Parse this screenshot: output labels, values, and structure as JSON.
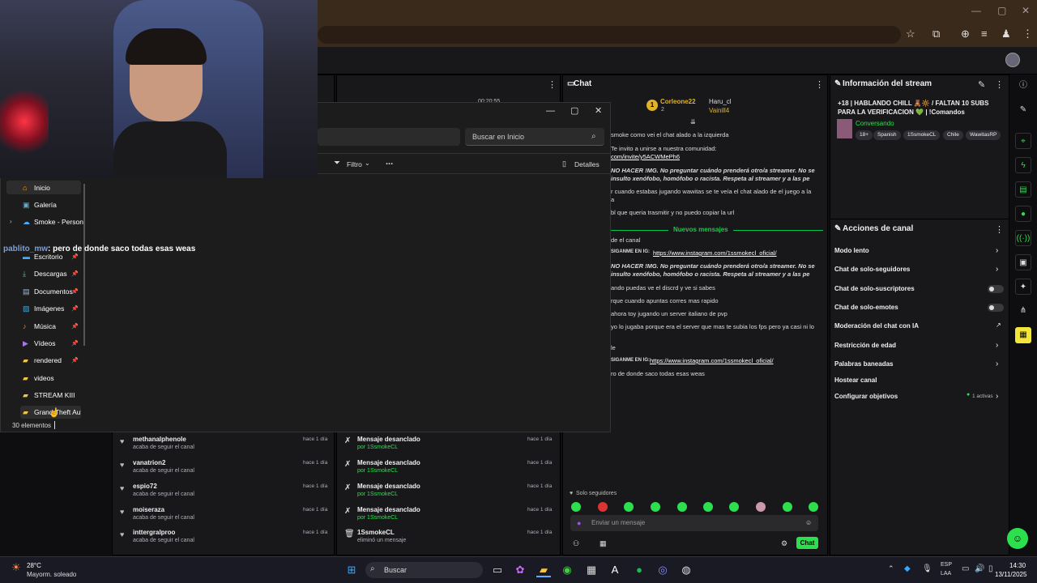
{
  "browser": {
    "icons": [
      "star-icon",
      "extensions-icon",
      "download-icon",
      "playlist-icon",
      "profile-icon",
      "menu-icon"
    ]
  },
  "explorer": {
    "search_placeholder": "Buscar en Inicio",
    "filter_label": "Filtro",
    "more_label": "...",
    "details_label": "Detalles",
    "nav": [
      {
        "label": "Inicio",
        "icon": "home-icon",
        "pinned": false
      },
      {
        "label": "Galería",
        "icon": "gallery-icon",
        "pinned": false
      },
      {
        "label": "Smoke - Person",
        "icon": "cloud-icon",
        "pinned": false
      },
      {
        "label": "Escritorio",
        "icon": "desktop-icon",
        "pinned": true
      },
      {
        "label": "Descargas",
        "icon": "download-icon",
        "pinned": true
      },
      {
        "label": "Documentos",
        "icon": "documents-icon",
        "pinned": true
      },
      {
        "label": "Imágenes",
        "icon": "images-icon",
        "pinned": true
      },
      {
        "label": "Música",
        "icon": "music-icon",
        "pinned": true
      },
      {
        "label": "Vídeos",
        "icon": "videos-icon",
        "pinned": true
      },
      {
        "label": "rendered",
        "icon": "folder-icon",
        "pinned": true
      },
      {
        "label": "videos",
        "icon": "folder-icon",
        "pinned": false
      },
      {
        "label": "STREAM KIII",
        "icon": "folder-icon",
        "pinned": false
      },
      {
        "label": "Grand Theft Aut",
        "icon": "folder-icon",
        "pinned": false
      }
    ],
    "status": "30 elementos"
  },
  "overlay_chat": {
    "user": "pablito_mw",
    "message": ": pero de donde saco todas esas weas"
  },
  "stream_time": "00:20:55",
  "chat": {
    "title": "Chat",
    "top_chatters": [
      {
        "name": "Corleone22",
        "count": "1"
      },
      {
        "name": "Haru_cl",
        "count": "1"
      },
      {
        "name": "Vainill4",
        "count": "1"
      }
    ],
    "top_badge": "1",
    "second_badge": "2",
    "lines": [
      {
        "text": "smoke como vei el chat alado a la izquierda"
      },
      {
        "text": "Te invito a unirse a nuestra comunidad:"
      },
      {
        "text": "com/invite/y5ACWMePh6"
      },
      {
        "text": "NO HACER !MG. No preguntar cuándo prenderá otro/a streamer. No se"
      },
      {
        "text": "insulto xenófobo, homófobo o racista. Respeta al streamer y a las pe"
      },
      {
        "text": "r cuando estabas jugando wawitas se te veía el chat alado de el juego a la"
      },
      {
        "text": "a"
      },
      {
        "text": "bl que queria trasmitir y no puedo copiar la url"
      }
    ],
    "new_messages_label": "Nuevos mensajes",
    "lines2": [
      {
        "text": "de el canal"
      },
      {
        "prefix": "SIGANME EN IG:",
        "link": "https://www.instagram.com/1ssmokecl_oficial/"
      },
      {
        "text": "NO HACER !MG. No preguntar cuándo prenderá otro/a streamer. No se"
      },
      {
        "text": "insulto xenófobo, homófobo o racista. Respeta al streamer y a las pe"
      },
      {
        "text": "ando puedas ve el discrd y ve si sabes"
      },
      {
        "text": "rque cuando apuntas corres mas rapido"
      },
      {
        "text": "ahora toy jugando un server italiano de pvp"
      },
      {
        "text": "yo lo jugaba porque era el server que mas te subia los fps pero ya casi ni lo"
      },
      {
        "text": "le"
      },
      {
        "prefix": "SIGANME EN IG:",
        "link": "https://www.instagram.com/1ssmokecl_oficial/"
      },
      {
        "text": "ro de donde saco todas esas weas"
      }
    ],
    "followers_only": "Solo seguidores",
    "input_placeholder": "Enviar un mensaje",
    "send_label": "Chat"
  },
  "info": {
    "title": "Información del stream",
    "stream_title": "+18 | HABLANDO CHILL 🧸🔆 / FALTAN 10 SUBS PARA LA VERIFICACION 💚 | !Comandos",
    "category": "Conversando",
    "tags": [
      "18+",
      "Spanish",
      "1SsmokeCL",
      "Chile",
      "WawitasRP"
    ]
  },
  "actions": {
    "title": "Acciones de canal",
    "items": [
      {
        "label": "Modo lento",
        "kind": "chevron"
      },
      {
        "label": "Chat de solo-seguidores",
        "kind": "chevron"
      },
      {
        "label": "Chat de solo-suscriptores",
        "kind": "toggle"
      },
      {
        "label": "Chat de solo-emotes",
        "kind": "toggle"
      },
      {
        "label": "Moderación del chat con IA",
        "kind": "external"
      },
      {
        "label": "Restricción de edad",
        "kind": "chevron"
      },
      {
        "label": "Palabras baneadas",
        "kind": "chevron"
      },
      {
        "label": "Hostear canal",
        "kind": "none"
      },
      {
        "label": "Configurar objetivos",
        "kind": "goals"
      }
    ],
    "goals_active": "1 activas"
  },
  "feed_left": [
    {
      "name": "methanalphenole",
      "sub": "acaba de seguir el canal",
      "time": "hace 1 día"
    },
    {
      "name": "vanatrion2",
      "sub": "acaba de seguir el canal",
      "time": "hace 1 día"
    },
    {
      "name": "espio72",
      "sub": "acaba de seguir el canal",
      "time": "hace 1 día"
    },
    {
      "name": "moiseraza",
      "sub": "acaba de seguir el canal",
      "time": "hace 1 día"
    },
    {
      "name": "inttergralproo",
      "sub": "acaba de seguir el canal",
      "time": "hace 1 día"
    }
  ],
  "feed_right": [
    {
      "name": "Mensaje desanclado",
      "sub": "por 1SsmokeCL",
      "time": "hace 1 día",
      "icon": "unpin-icon"
    },
    {
      "name": "Mensaje desanclado",
      "sub": "por 1SsmokeCL",
      "time": "hace 1 día",
      "icon": "unpin-icon"
    },
    {
      "name": "Mensaje desanclado",
      "sub": "por 1SsmokeCL",
      "time": "hace 1 día",
      "icon": "unpin-icon"
    },
    {
      "name": "Mensaje desanclado",
      "sub": "por 1SsmokeCL",
      "time": "hace 1 día",
      "icon": "unpin-icon"
    },
    {
      "name": "1SsmokeCL",
      "sub": "eliminó un mensaje",
      "time": "hace 1 día",
      "icon": "trash-icon"
    }
  ],
  "taskbar": {
    "weather_temp": "28°C",
    "weather_desc": "Mayorm. soleado",
    "search": "Buscar",
    "lang1": "ESP",
    "lang2": "LAA",
    "time": "14:30",
    "date": "13/11/2025"
  },
  "colors": {
    "accent": "#2be04c",
    "bg": "#18181b",
    "browser": "#3a2a1c"
  }
}
